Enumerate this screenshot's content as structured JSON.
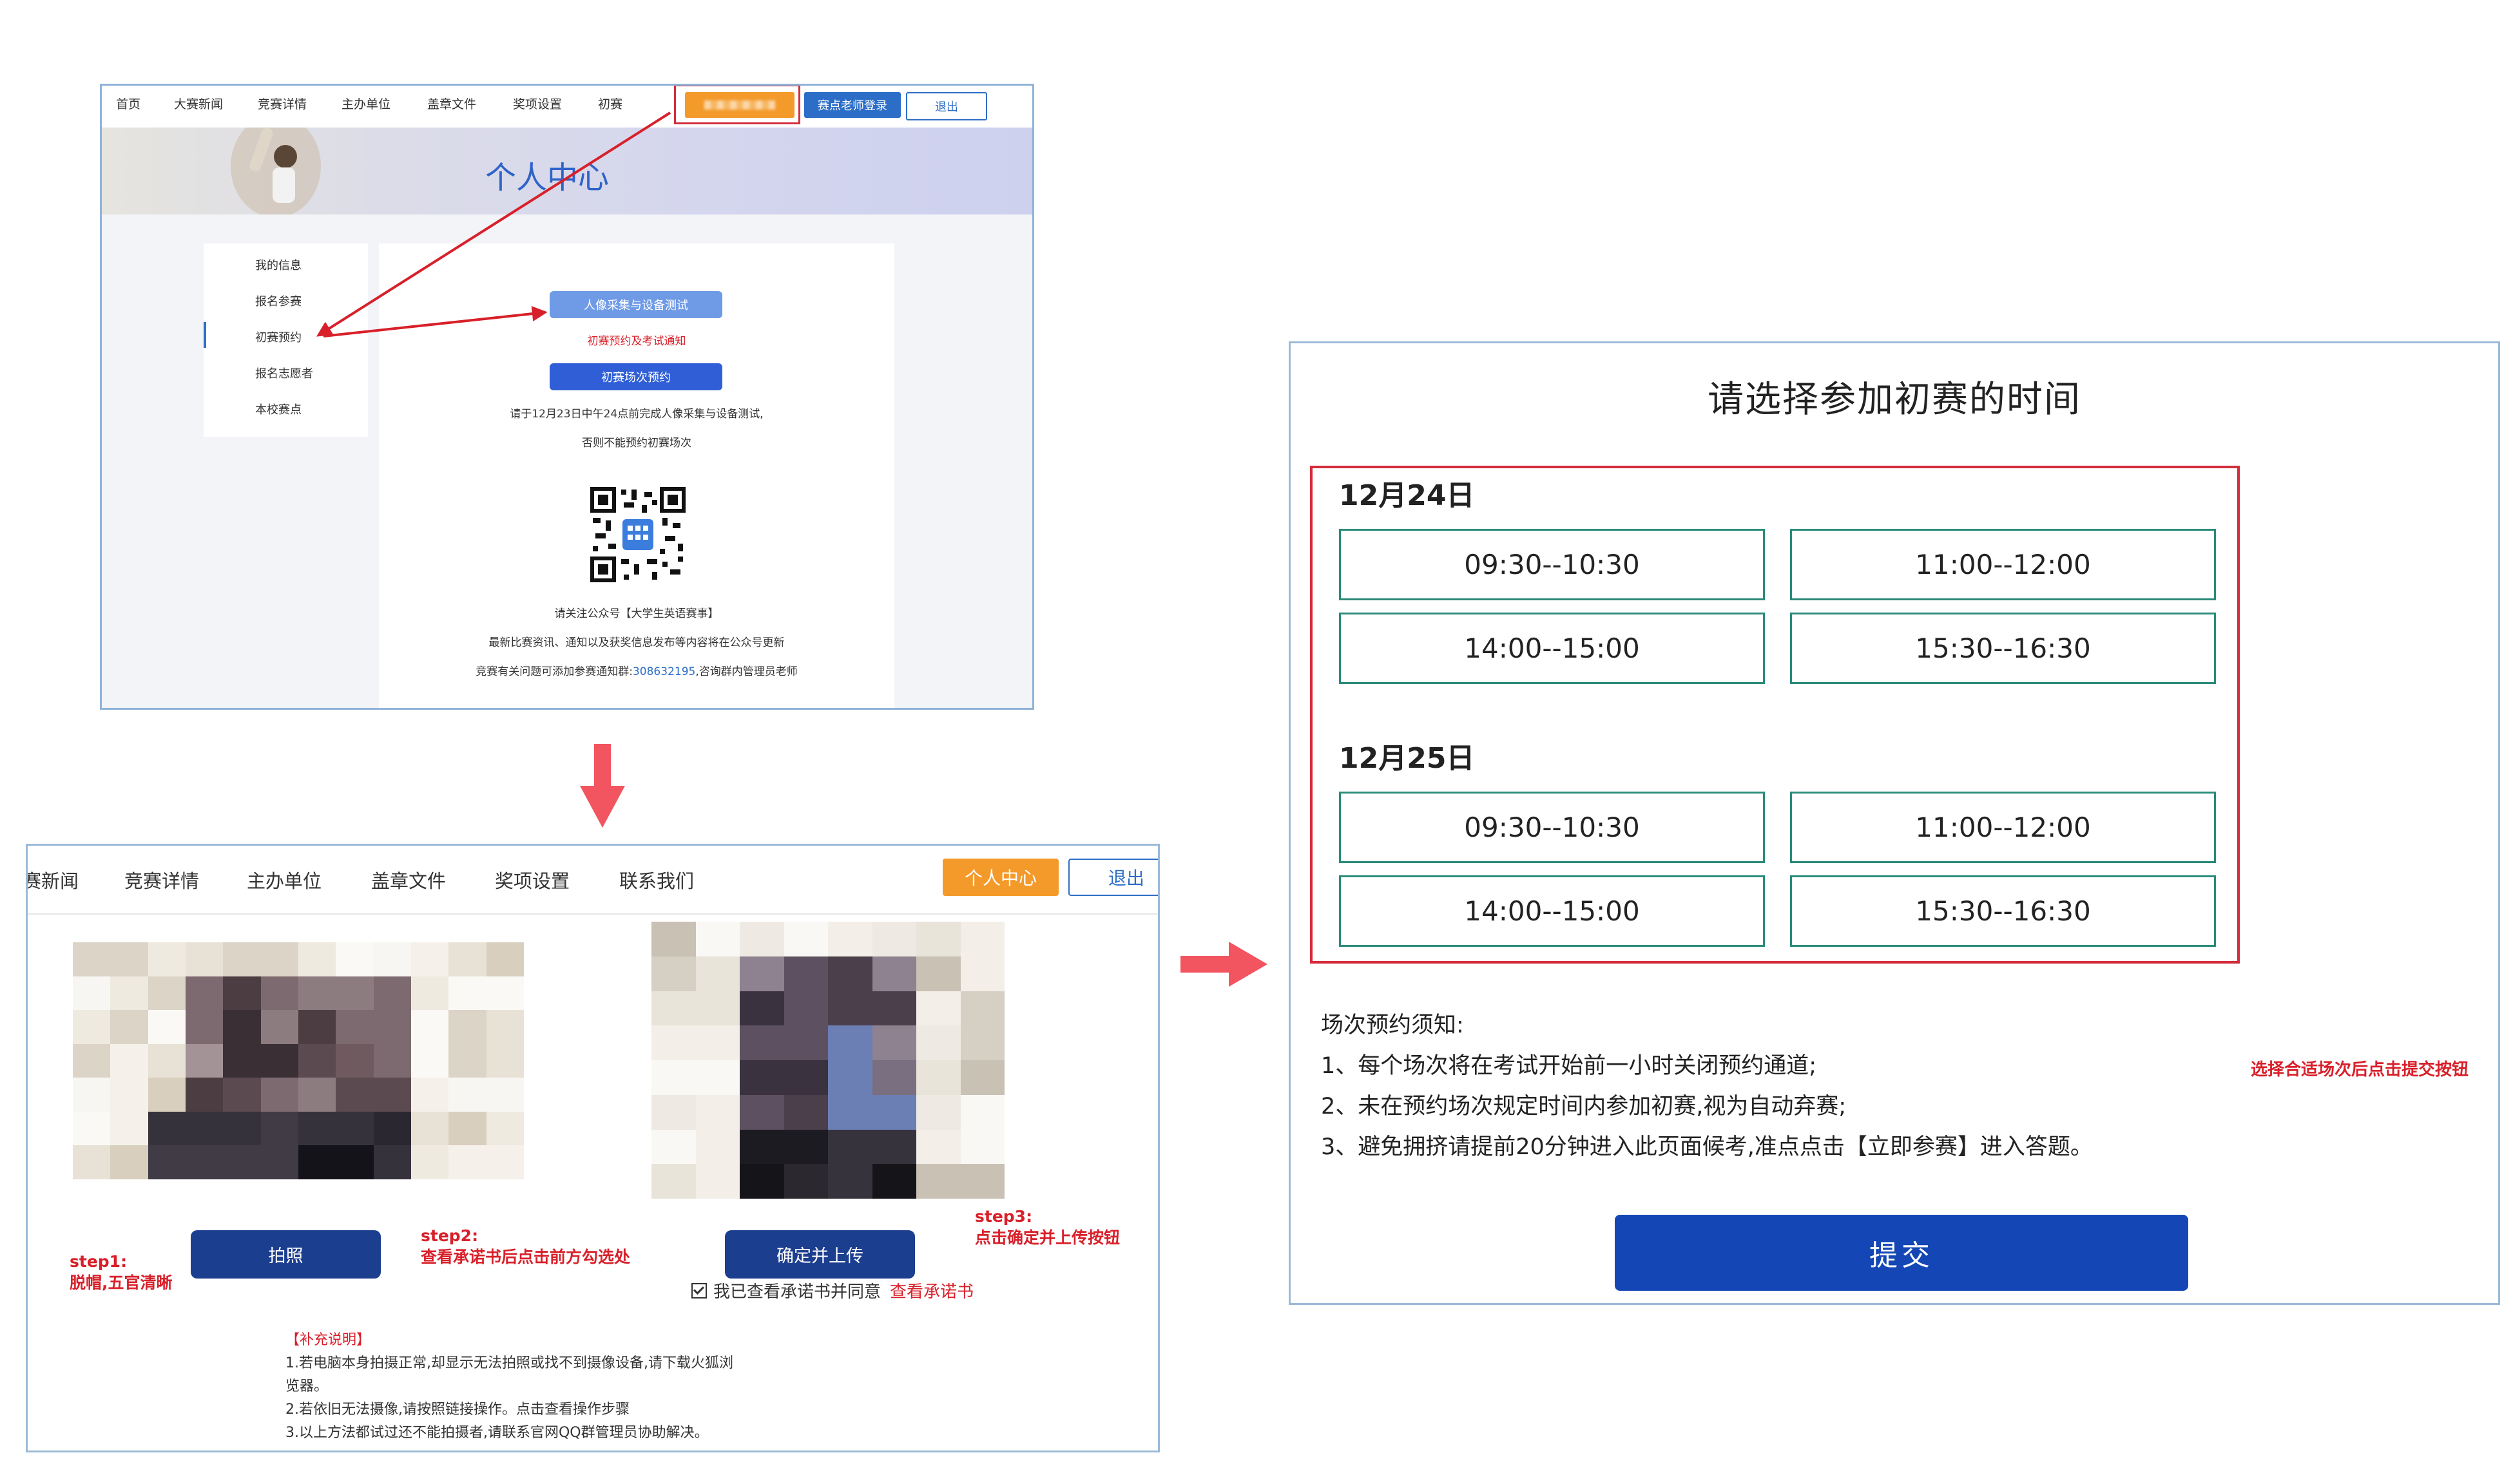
{
  "panel1": {
    "nav": [
      "首页",
      "大赛新闻",
      "竞赛详情",
      "主办单位",
      "盖章文件",
      "奖项设置",
      "初赛"
    ],
    "login_btn": "赛点老师登录",
    "logout_btn": "退出",
    "banner_title": "个人中心",
    "menu": [
      "我的信息",
      "报名参赛",
      "初赛预约",
      "报名志愿者",
      "本校赛点"
    ],
    "btn_capture": "人像采集与设备测试",
    "notice_red": "初赛预约及考试通知",
    "btn_reserve": "初赛场次预约",
    "instr1": "请于12月23日中午24点前完成人像采集与设备测试,",
    "instr2": "否则不能预约初赛场次",
    "follow": "请关注公众号【大学生英语赛事】",
    "news": "最新比赛资讯、通知以及获奖信息发布等内容将在公众号更新",
    "qq_prefix": "竞赛有关问题可添加参赛通知群:",
    "qq_number": "308632195",
    "qq_suffix": ",咨询群内管理员老师"
  },
  "panel2": {
    "nav": [
      "赛新闻",
      "竞赛详情",
      "主办单位",
      "盖章文件",
      "奖项设置",
      "联系我们"
    ],
    "personal_center": "个人中心",
    "logout": "退出",
    "btn_photo": "拍照",
    "btn_upload": "确定并上传",
    "step1_title": "step1:",
    "step1_desc": "脱帽,五官清晰",
    "step2_title": "step2:",
    "step2_desc": "查看承诺书后点击前方勾选处",
    "step3_title": "step3:",
    "step3_desc": "点击确定并上传按钮",
    "agree_text": "我已查看承诺书并同意",
    "agree_link": "查看承诺书",
    "supplement_title": "【补充说明】",
    "supplement": [
      "1.若电脑本身拍摄正常,却显示无法拍照或找不到摄像设备,请下载火狐浏",
      "览器。",
      "2.若依旧无法摄像,请按照链接操作。点击查看操作步骤",
      "3.以上方法都试过还不能拍摄者,请联系官网QQ群管理员协助解决。"
    ]
  },
  "panel3": {
    "title": "请选择参加初赛的时间",
    "days": [
      {
        "date": "12月24日",
        "slots": [
          "09:30--10:30",
          "11:00--12:00",
          "14:00--15:00",
          "15:30--16:30"
        ]
      },
      {
        "date": "12月25日",
        "slots": [
          "09:30--10:30",
          "11:00--12:00",
          "14:00--15:00",
          "15:30--16:30"
        ]
      }
    ],
    "notice_title": "场次预约须知:",
    "notice": [
      "1、每个场次将在考试开始前一小时关闭预约通道;",
      "2、未在预约场次规定时间内参加初赛,视为自动弃赛;",
      "3、避免拥挤请提前20分钟进入此页面候考,准点点击【立即参赛】进入答题。"
    ],
    "submit": "提交",
    "annotation": "选择合适场次后点击提交按钮"
  },
  "colors": {
    "red": "#d8202a",
    "orange": "#f39a2b",
    "blue": "#1c3e8f",
    "slot_border": "#2a8b7a",
    "submit_blue": "#1447b5"
  }
}
